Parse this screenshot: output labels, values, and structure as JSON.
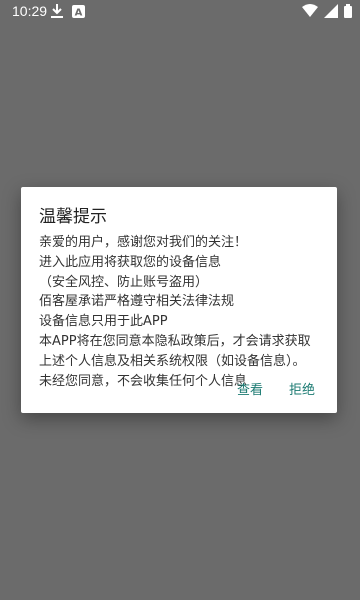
{
  "status_bar": {
    "time": "10:29",
    "icons": [
      "download-icon",
      "notification-a-icon",
      "wifi-icon",
      "signal-icon",
      "battery-icon"
    ],
    "notif_letter": "A"
  },
  "dialog": {
    "title": "温馨提示",
    "lines": [
      "亲爱的用户，感谢您对我们的关注！",
      "进入此应用将获取您的设备信息",
      "（安全风控、防止账号盗用）",
      "佰客屋承诺严格遵守相关法律法规",
      "设备信息只用于此APP",
      "本APP将在您同意本隐私政策后，才会请求获取",
      "上述个人信息及相关系统权限（如设备信息）。",
      "未经您同意，不会收集任何个人信息"
    ],
    "buttons": {
      "view": "查看",
      "reject": "拒绝"
    }
  },
  "colors": {
    "overlay": "#6b6b6b",
    "accent": "#1b7a72",
    "dialog_bg": "#ffffff"
  }
}
